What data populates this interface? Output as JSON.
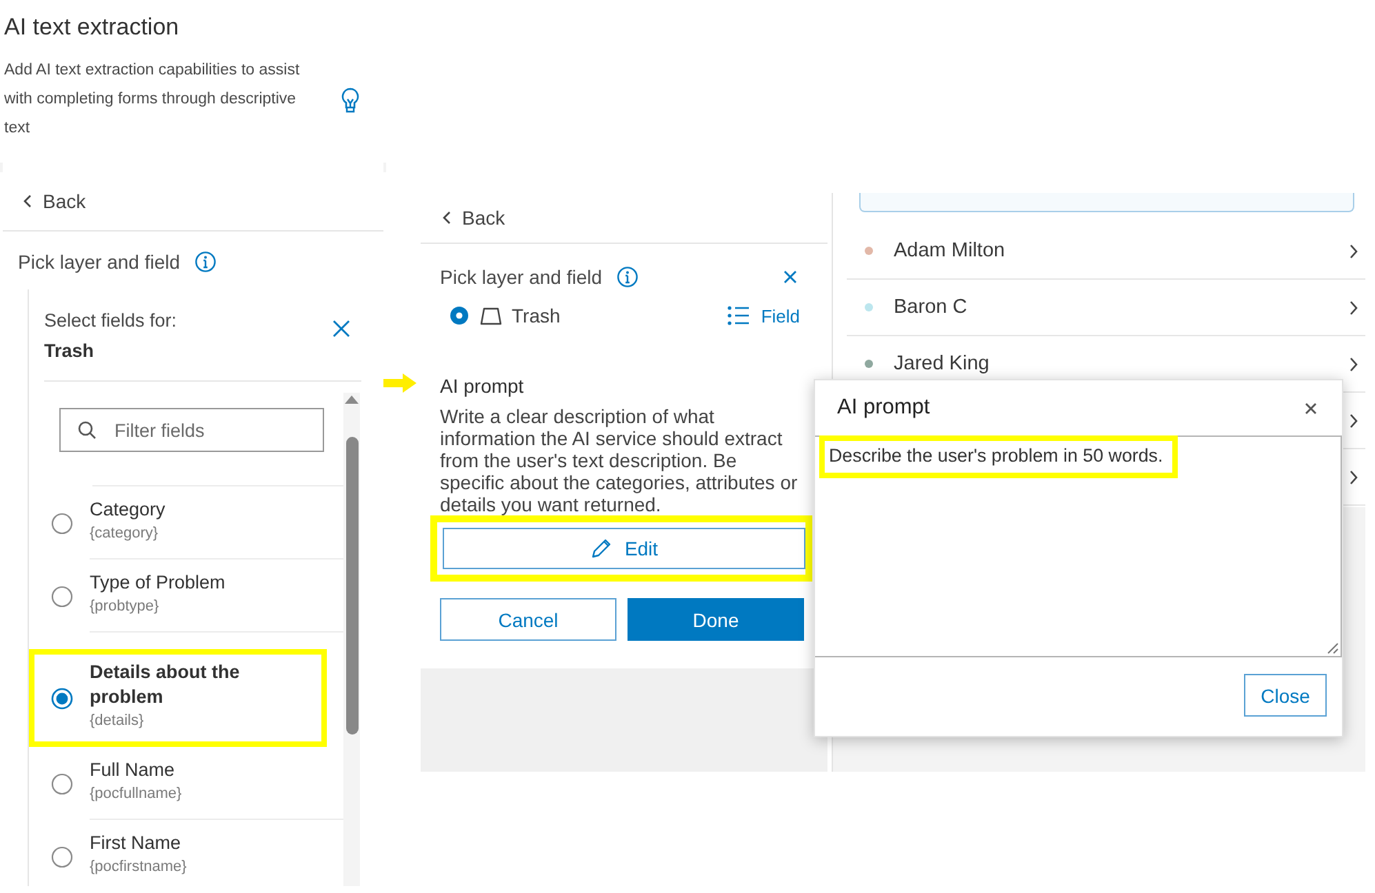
{
  "header": {
    "title": "AI text extraction",
    "description": "Add AI text extraction capabilities to assist with completing forms through descriptive text"
  },
  "field_picker": {
    "back": "Back",
    "heading": "Pick layer and field",
    "select_label": "Select fields for:",
    "layer": "Trash",
    "filter": {
      "placeholder": "Filter fields"
    },
    "fields": [
      {
        "label": "Category",
        "name": "{category}",
        "selected": false,
        "highlighted": false
      },
      {
        "label": "Type of Problem",
        "name": "{probtype}",
        "selected": false,
        "highlighted": false
      },
      {
        "label": "Details about the problem",
        "name": "{details}",
        "selected": true,
        "highlighted": true
      },
      {
        "label": "Full Name",
        "name": "{pocfullname}",
        "selected": false,
        "highlighted": false
      },
      {
        "label": "First Name",
        "name": "{pocfirstname}",
        "selected": false,
        "highlighted": false
      }
    ]
  },
  "prompt_panel": {
    "back": "Back",
    "heading": "Pick layer and field",
    "layer": "Trash",
    "layer_selected": true,
    "field_button": "Field",
    "prompt_label": "AI prompt",
    "prompt_pointed": true,
    "prompt_help": "Write a clear description of what information the AI service should extract from the user's text description. Be specific about the categories, attributes or details you want returned.",
    "edit_button": {
      "label": "Edit",
      "highlighted": true
    },
    "cancel_button": "Cancel",
    "done_button": "Done"
  },
  "record_list": {
    "rows": [
      {
        "kind": "named",
        "name": "Adam Milton",
        "color": "#e2b8a8"
      },
      {
        "kind": "named",
        "name": "Baron C",
        "color": "#bce6ee"
      },
      {
        "kind": "named",
        "name": "Jared King",
        "color": "#8fa89f"
      },
      {
        "kind": "covered"
      },
      {
        "kind": "covered"
      }
    ]
  },
  "dialog": {
    "title": "AI prompt",
    "value": "Describe the user's problem in 50 words.",
    "value_highlighted": true,
    "close_button": "Close"
  }
}
